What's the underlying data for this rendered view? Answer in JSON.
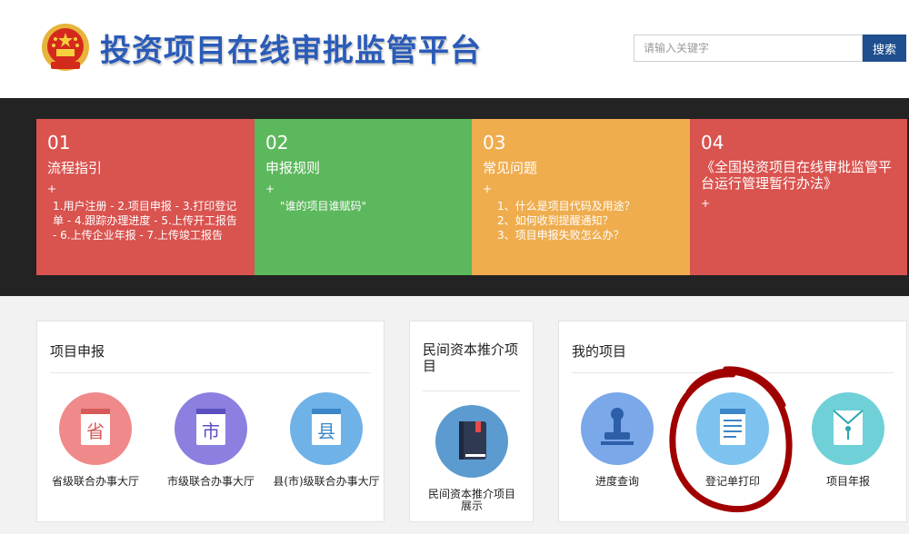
{
  "header": {
    "title": "投资项目在线审批监管平台",
    "search_placeholder": "请输入关键字",
    "search_button": "搜索",
    "emblem_icon": "national-emblem-icon"
  },
  "cards": [
    {
      "num": "01",
      "title": "流程指引",
      "plus": "+",
      "desc": "1.用户注册 - 2.项目申报 - 3.打印登记单 - 4.跟踪办理进度 - 5.上传开工报告 - 6.上传企业年报 - 7.上传竣工报告",
      "color": "#d9534f"
    },
    {
      "num": "02",
      "title": "申报规则",
      "plus": "+",
      "desc": "\"谁的项目谁赋码\"",
      "color": "#5cb85c"
    },
    {
      "num": "03",
      "title": "常见问题",
      "plus": "+",
      "desc": "1、什么是项目代码及用途？\n2、如何收到提醒通知？\n3、项目申报失败怎么办？",
      "color": "#efad4e"
    },
    {
      "num": "04",
      "title": "《全国投资项目在线审批监管平台运行管理暂行办法》",
      "plus": "+",
      "desc": "",
      "color": "#d9534f"
    }
  ],
  "panels": {
    "project_declare": {
      "title": "项目申报",
      "items": [
        {
          "label": "省级联合办事大厅",
          "glyph": "省",
          "icon": "province-hall-icon",
          "color": "#f08a8a"
        },
        {
          "label": "市级联合办事大厅",
          "glyph": "市",
          "icon": "city-hall-icon",
          "color": "#8b7fe0"
        },
        {
          "label": "县(市)级联合办事大厅",
          "glyph": "县",
          "icon": "county-hall-icon",
          "color": "#6fb2e8"
        }
      ]
    },
    "private_capital": {
      "title": "民间资本推介项目",
      "items": [
        {
          "label": "民间资本推介项目展示",
          "icon": "book-icon",
          "color": "#5b9bd0"
        }
      ]
    },
    "my_projects": {
      "title": "我的项目",
      "items": [
        {
          "label": "进度查询",
          "icon": "stamp-icon",
          "color": "#7aa8e8"
        },
        {
          "label": "登记单打印",
          "icon": "form-document-icon",
          "color": "#7ec3ef"
        },
        {
          "label": "项目年报",
          "icon": "envelope-icon",
          "color": "#6fd0d8"
        }
      ]
    }
  },
  "annotation": {
    "icon": "red-hand-drawn-circle",
    "color": "#a00000"
  }
}
